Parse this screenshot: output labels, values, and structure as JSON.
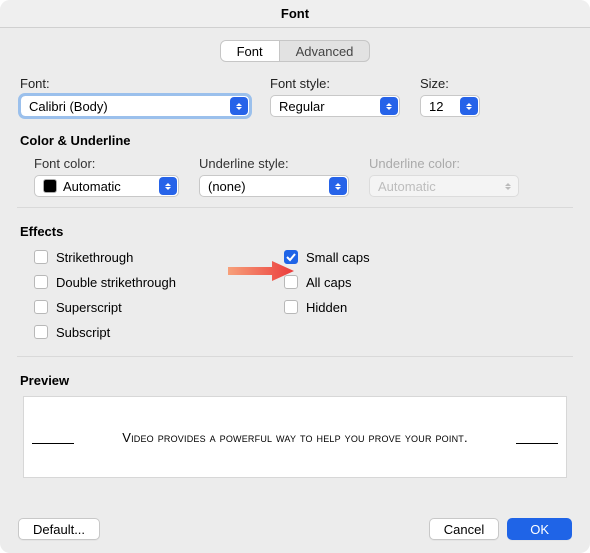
{
  "window": {
    "title": "Font"
  },
  "tabs": {
    "font": "Font",
    "advanced": "Advanced"
  },
  "labels": {
    "font": "Font:",
    "font_style": "Font style:",
    "size": "Size:",
    "color_underline": "Color & Underline",
    "font_color": "Font color:",
    "underline_style": "Underline style:",
    "underline_color": "Underline color:",
    "effects": "Effects",
    "preview": "Preview"
  },
  "values": {
    "font": "Calibri (Body)",
    "font_style": "Regular",
    "size": "12",
    "font_color": "Automatic",
    "underline_style": "(none)",
    "underline_color": "Automatic"
  },
  "effects": {
    "strikethrough": "Strikethrough",
    "double_strikethrough": "Double strikethrough",
    "superscript": "Superscript",
    "subscript": "Subscript",
    "small_caps": "Small caps",
    "all_caps": "All caps",
    "hidden": "Hidden"
  },
  "preview_text": "Video provides a powerful way to help you prove your point.",
  "buttons": {
    "default": "Default...",
    "cancel": "Cancel",
    "ok": "OK"
  }
}
